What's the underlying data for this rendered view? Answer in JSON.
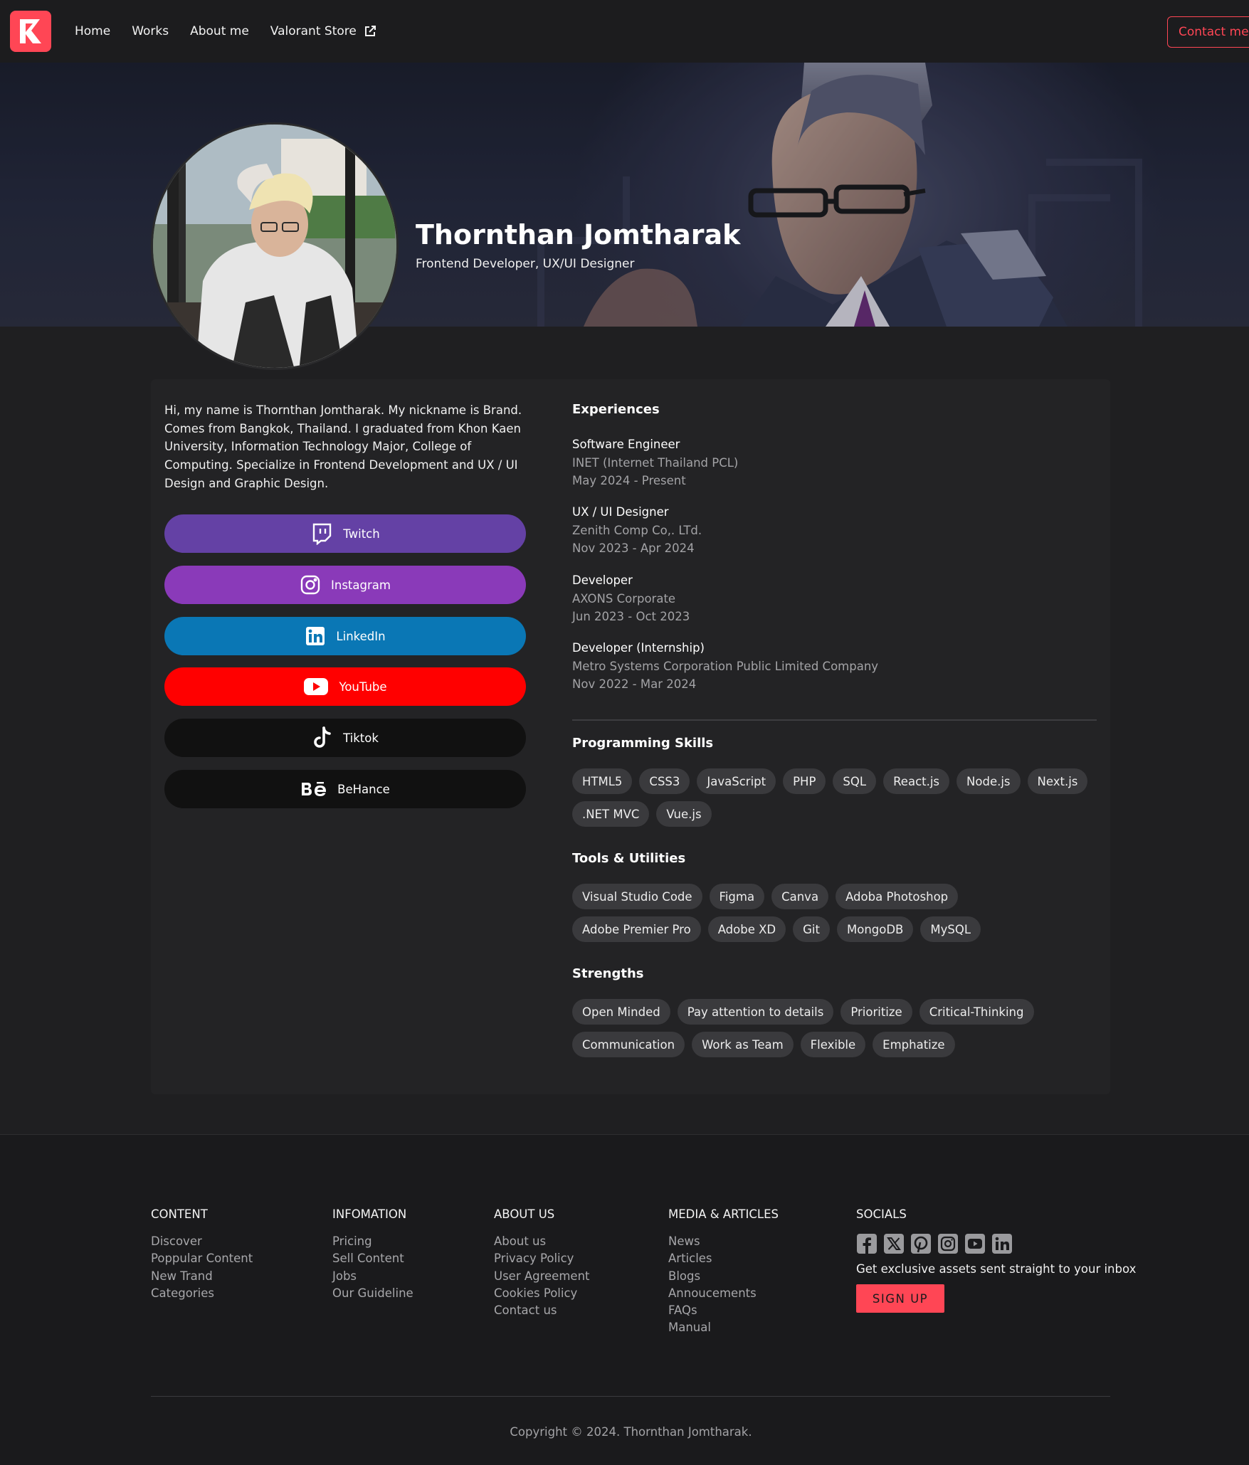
{
  "nav": {
    "links": [
      "Home",
      "Works",
      "About me",
      "Valorant Store"
    ],
    "contact_label": "Contact me",
    "logo_icon": "brand-logo-icon",
    "external_icon": "external-link-icon"
  },
  "hero": {
    "name": "Thornthan Jomtharak",
    "role": "Frontend Developer, UX/UI Designer"
  },
  "about": {
    "bio": "Hi, my name is Thornthan Jomtharak. My nickname is Brand. Comes from Bangkok, Thailand. I graduated from Khon Kaen University, Information Technology Major, College of Computing. Specialize in Frontend Development and UX / UI Design and Graphic Design.",
    "socials": [
      {
        "label": "Twitch",
        "icon": "twitch-icon",
        "color": "#6441a5"
      },
      {
        "label": "Instagram",
        "icon": "instagram-icon",
        "color": "#8a3ab9"
      },
      {
        "label": "LinkedIn",
        "icon": "linkedin-icon",
        "color": "#0a77b5"
      },
      {
        "label": "YouTube",
        "icon": "youtube-icon",
        "color": "#ff0000"
      },
      {
        "label": "Tiktok",
        "icon": "tiktok-icon",
        "color": "#111111"
      },
      {
        "label": "BeHance",
        "icon": "behance-icon",
        "color": "#111111"
      }
    ]
  },
  "experiences": {
    "title": "Experiences",
    "items": [
      {
        "role": "Software Engineer",
        "company": "INET (Internet Thailand PCL)",
        "period": "May 2024 - Present"
      },
      {
        "role": "UX / UI Designer",
        "company": "Zenith Comp Co,. LTd.",
        "period": "Nov 2023 - Apr 2024"
      },
      {
        "role": "Developer",
        "company": "AXONS Corporate",
        "period": "Jun 2023 - Oct 2023"
      },
      {
        "role": "Developer (Internship)",
        "company": "Metro Systems Corporation Public Limited Company",
        "period": "Nov 2022 - Mar 2024"
      }
    ]
  },
  "skills": {
    "programming_title": "Programming Skills",
    "programming": [
      "HTML5",
      "CSS3",
      "JavaScript",
      "PHP",
      "SQL",
      "React.js",
      "Node.js",
      "Next.js",
      ".NET MVC",
      "Vue.js"
    ],
    "tools_title": "Tools & Utilities",
    "tools": [
      "Visual Studio Code",
      "Figma",
      "Canva",
      "Adoba Photoshop",
      "Adobe Premier Pro",
      "Adobe XD",
      "Git",
      "MongoDB",
      "MySQL"
    ],
    "strengths_title": "Strengths",
    "strengths": [
      "Open Minded",
      "Pay attention to details",
      "Prioritize",
      "Critical-Thinking",
      "Communication",
      "Work as Team",
      "Flexible",
      "Emphatize"
    ]
  },
  "footer": {
    "columns": [
      {
        "title": "CONTENT",
        "links": [
          "Discover",
          "Poppular Content",
          "New Trand",
          "Categories"
        ]
      },
      {
        "title": "INFOMATION",
        "links": [
          "Pricing",
          "Sell Content",
          "Jobs",
          "Our Guideline"
        ]
      },
      {
        "title": "ABOUT US",
        "links": [
          "About us",
          "Privacy Policy",
          "User Agreement",
          "Cookies Policy",
          "Contact us"
        ]
      },
      {
        "title": "MEDIA & ARTICLES",
        "links": [
          "News",
          "Articles",
          "Blogs",
          "Annoucements",
          "FAQs",
          "Manual"
        ]
      }
    ],
    "socials_title": "SOCIALS",
    "social_icons": [
      "facebook-icon",
      "x-icon",
      "pinterest-icon",
      "instagram-icon",
      "youtube-icon",
      "linkedin-icon"
    ],
    "newsletter": "Get exclusive assets sent straight to your inbox",
    "signup_label": "SIGN UP",
    "copyright": "Copyright © 2024. Thornthan Jomtharak."
  },
  "colors": {
    "accent": "#ff4655",
    "background": "#1f1f21",
    "card": "#232325",
    "chip": "#3a3a3d"
  }
}
